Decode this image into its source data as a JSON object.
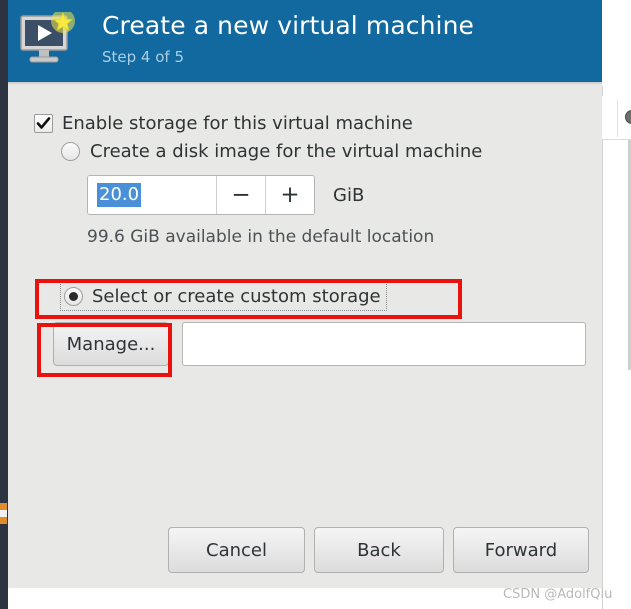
{
  "window": {
    "title": "Create a new virtual machine",
    "step": "Step 4 of 5"
  },
  "icons": {
    "app": "virtual-machine-monitor-icon",
    "checkmark": "checkmark-icon",
    "minus": "−",
    "plus": "+"
  },
  "form": {
    "enable_storage": {
      "label": "Enable storage for this virtual machine",
      "checked": true
    },
    "disk_image_option": {
      "label": "Create a disk image for the virtual machine",
      "selected": false
    },
    "size_spinner": {
      "value": "20.0",
      "unit": "GiB",
      "decrement_label": "−",
      "increment_label": "+"
    },
    "available_note": "99.6 GiB available in the default location",
    "custom_storage_option": {
      "label": "Select or create custom storage",
      "selected": true
    },
    "manage_button": "Manage...",
    "storage_path": {
      "value": "",
      "placeholder": ""
    }
  },
  "footer": {
    "cancel": "Cancel",
    "back": "Back",
    "forward": "Forward"
  },
  "watermark": "CSDN @AdolfQiu",
  "colors": {
    "header_blue": "#11699f",
    "dialog_bg": "#e8e8e6",
    "selection_blue": "#4a90d9",
    "annotation_red": "#e8120f",
    "step_text": "#a8cfe4"
  }
}
